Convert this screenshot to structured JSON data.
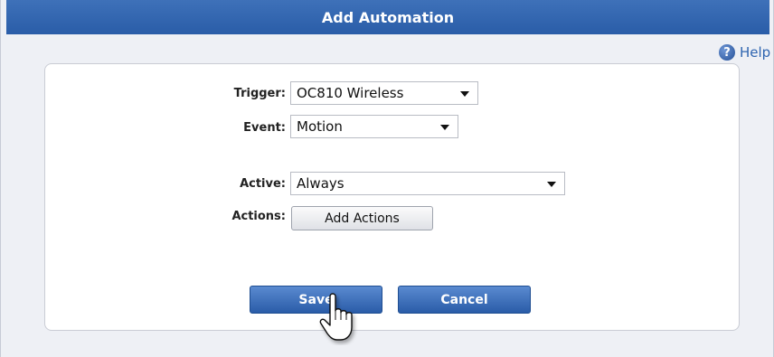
{
  "dialog": {
    "title": "Add Automation",
    "help_label": "Help",
    "help_icon_glyph": "?"
  },
  "form": {
    "trigger": {
      "label": "Trigger:",
      "value": "OC810 Wireless"
    },
    "event": {
      "label": "Event:",
      "value": "Motion"
    },
    "active": {
      "label": "Active:",
      "value": "Always"
    },
    "actions": {
      "label": "Actions:",
      "button_label": "Add Actions"
    }
  },
  "buttons": {
    "save_label": "Save",
    "cancel_label": "Cancel"
  },
  "colors": {
    "titlebar": "#2f63ae",
    "button_blue": "#2a5ca8",
    "help_link": "#2e64b0"
  },
  "icons": {
    "help": "help-icon",
    "caret": "chevron-down-icon",
    "pointer": "hand-pointer-icon"
  }
}
